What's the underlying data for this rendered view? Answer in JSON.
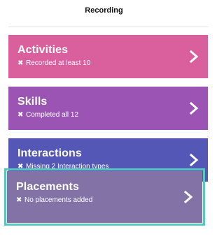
{
  "header": {
    "title": "Recording"
  },
  "cards": [
    {
      "title": "Activities",
      "status": "Recorded at least 10",
      "status_icon": "x-icon",
      "color": "#d95f9d"
    },
    {
      "title": "Skills",
      "status": "Completed all 12",
      "status_icon": "x-icon",
      "color": "#9b54b4"
    },
    {
      "title": "Interactions",
      "status": "Missing 2 Interaction types",
      "status_icon": "x-icon",
      "color": "#5457b6"
    },
    {
      "title": "Placements",
      "status": "No placements added",
      "status_icon": "x-icon",
      "color": "#8272a5",
      "selected": true
    }
  ],
  "selection_color": "#55c6c0",
  "glyphs": {
    "x": "✖"
  }
}
